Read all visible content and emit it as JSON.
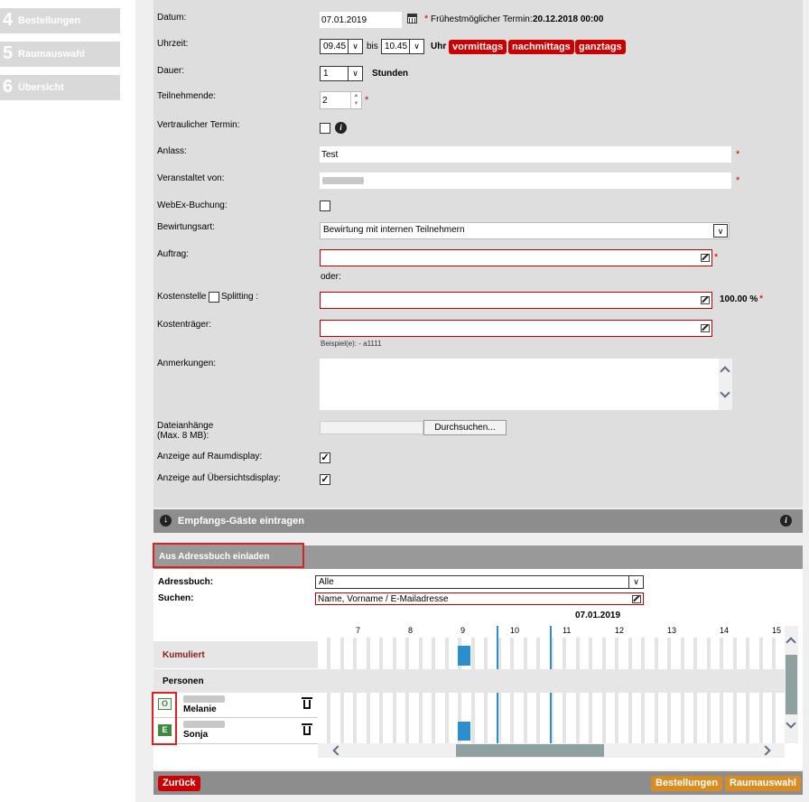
{
  "sidebar": {
    "steps": [
      {
        "num": "4",
        "label": "Bestellungen"
      },
      {
        "num": "5",
        "label": "Raumauswahl"
      },
      {
        "num": "6",
        "label": "Übersicht"
      }
    ]
  },
  "form": {
    "datum_label": "Datum:",
    "datum_value": "07.01.2019",
    "earliest_star": "*",
    "earliest_text": "Frühestmöglicher Termin:",
    "earliest_value": "20.12.2018 00:00",
    "uhrzeit_label": "Uhrzeit:",
    "time_from": "09.45",
    "bis": "bis",
    "time_to": "10.45",
    "uhr": "Uhr",
    "btn_vormittags": "vormittags",
    "btn_nachmittags": "nachmittags",
    "btn_ganztags": "ganztags",
    "dauer_label": "Dauer:",
    "dauer_value": "1",
    "stunden": "Stunden",
    "teilnehmende_label": "Teilnehmende:",
    "teilnehmende_value": "2",
    "vertraulich_label": "Vertraulicher Termin:",
    "anlass_label": "Anlass:",
    "anlass_value": "Test",
    "veranstaltet_label": "Veranstaltet von:",
    "webex_label": "WebEx-Buchung:",
    "bewirtung_label": "Bewirtungsart:",
    "bewirtung_value": "Bewirtung mit internen Teilnehmern",
    "auftrag_label": "Auftrag:",
    "oder": "oder:",
    "kostenstelle_label": "Kostenstelle",
    "splitting_label": "Splitting :",
    "percent": "100.00 %",
    "kostentraeger_label": "Kostenträger:",
    "beispiel": "Beispiel(e): - a1111",
    "anmerkungen_label": "Anmerkungen:",
    "datei_label_1": "Dateianhänge",
    "datei_label_2": "(Max. 8 MB):",
    "durchsuchen": "Durchsuchen...",
    "raumdisplay_label": "Anzeige auf Raumdisplay:",
    "uebersicht_label": "Anzeige auf Übersichtsdisplay:",
    "req": "*"
  },
  "empfang": {
    "label": "Empfangs-Gäste eintragen"
  },
  "adressbuch": {
    "header": "Aus Adressbuch einladen",
    "adressbuch_label": "Adressbuch:",
    "adressbuch_value": "Alle",
    "suchen_label": "Suchen:",
    "suchen_placeholder": "Name, Vorname / E-Mailadresse"
  },
  "schedule": {
    "date": "07.01.2019",
    "hours": [
      "7",
      "8",
      "9",
      "10",
      "11",
      "12",
      "13",
      "14",
      "15"
    ],
    "kumuliert": "Kumuliert",
    "personen": "Personen",
    "persons": [
      {
        "role": "O",
        "name": "Melanie",
        "role_color": "#f2f2f2"
      },
      {
        "role": "E",
        "name": "Sonja",
        "role_color": "#3f8a3f"
      }
    ]
  },
  "footer": {
    "zurueck": "Zurück",
    "bestellungen": "Bestellungen",
    "raumauswahl": "Raumauswahl"
  },
  "colors": {
    "accent_red": "#c00000",
    "accent_orange": "#d98c1f",
    "booking_blue": "#2a8fd0"
  }
}
